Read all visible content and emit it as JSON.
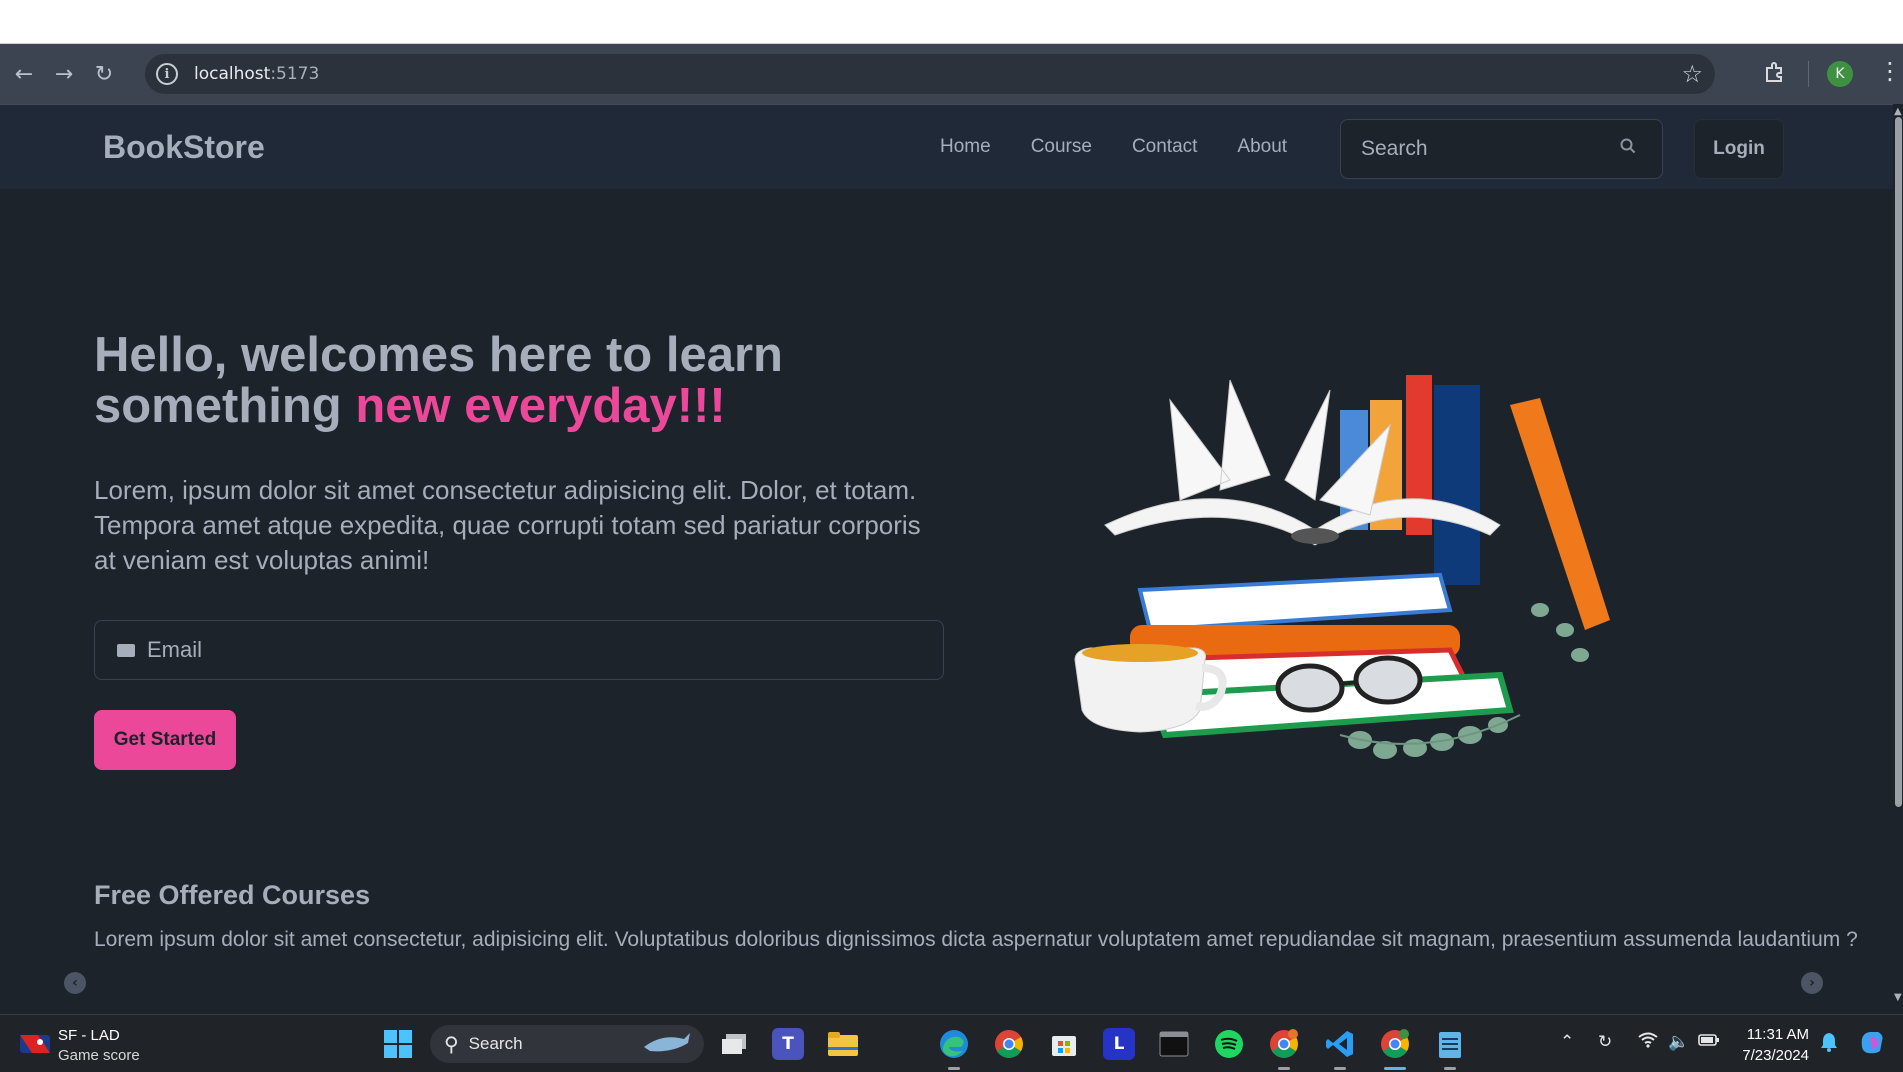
{
  "browser": {
    "url_host": "localhost",
    "url_port": ":5173",
    "profile_initial": "K"
  },
  "site": {
    "brand": "BookStore",
    "nav": [
      "Home",
      "Course",
      "Contact",
      "About"
    ],
    "search_placeholder": "Search",
    "login_label": "Login"
  },
  "hero": {
    "title_plain": "Hello, welcomes here to learn something ",
    "title_accent": "new everyday!!!",
    "text": "Lorem, ipsum dolor sit amet consectetur adipisicing elit. Dolor, et totam. Tempora amet atque expedita, quae corrupti totam sed pariatur corporis at veniam est voluptas animi!",
    "email_placeholder": "Email",
    "cta_label": "Get Started"
  },
  "courses": {
    "title": "Free Offered Courses",
    "text": "Lorem ipsum dolor sit amet consectetur, adipisicing elit. Voluptatibus doloribus dignissimos dicta aspernatur voluptatem amet repudiandae sit magnam, praesentium assumenda laudantium ?"
  },
  "taskbar": {
    "widget_title": "SF - LAD",
    "widget_subtitle": "Game score",
    "search_label": "Search",
    "time": "11:31 AM",
    "date": "7/23/2024"
  },
  "colors": {
    "accent": "#ec4899",
    "background": "#1d232a",
    "navbar": "#1f2937",
    "text": "#a6adbb"
  }
}
